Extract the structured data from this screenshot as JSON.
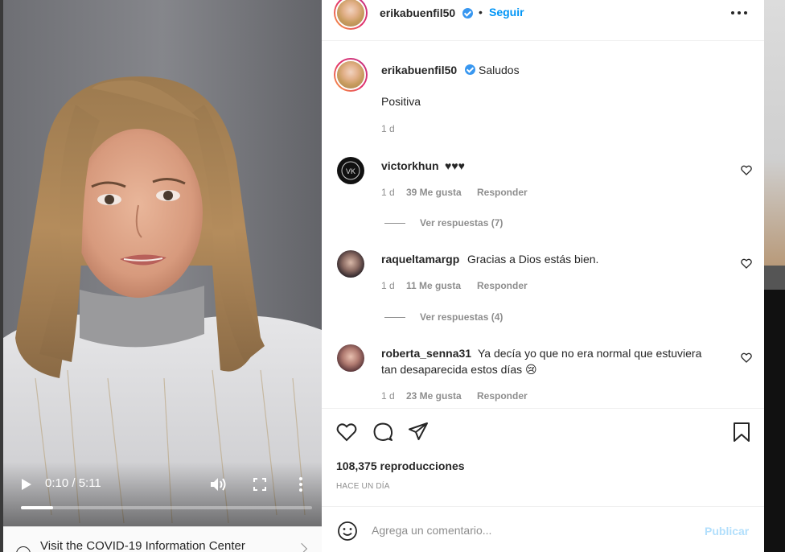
{
  "video": {
    "time": "0:10 / 5:11",
    "progress": 0.11
  },
  "covid": {
    "text": "Visit the COVID-19 Information Center"
  },
  "post": {
    "username": "erikabuenfil50",
    "separator": "•",
    "follow_label": "Seguir",
    "caption_username": "erikabuenfil50",
    "caption_title": "Saludos",
    "caption_body": "Positiva",
    "caption_time": "1 d"
  },
  "comments": [
    {
      "username": "victorkhun",
      "text": "♥♥♥",
      "time": "1 d",
      "likes": "39 Me gusta",
      "reply": "Responder",
      "view_replies": "Ver respuestas (7)"
    },
    {
      "username": "raqueltamargp",
      "text": "Gracias a Dios estás bien.",
      "time": "1 d",
      "likes": "11 Me gusta",
      "reply": "Responder",
      "view_replies": "Ver respuestas (4)"
    },
    {
      "username": "roberta_senna31",
      "text_line1": "Ya decía yo que no era normal que estuviera",
      "text_line2": "tan desaparecida estos días 😢",
      "time": "1 d",
      "likes": "23 Me gusta",
      "reply": "Responder"
    }
  ],
  "stats": {
    "views": "108,375 reproducciones",
    "posted": "HACE UN DÍA"
  },
  "composer": {
    "placeholder": "Agrega un comentario...",
    "publish_label": "Publicar"
  },
  "colors": {
    "link_blue": "#0095f6",
    "publish_disabled": "#b2dffc",
    "verified_blue": "#3897f0",
    "muted": "#8e8e8e"
  }
}
